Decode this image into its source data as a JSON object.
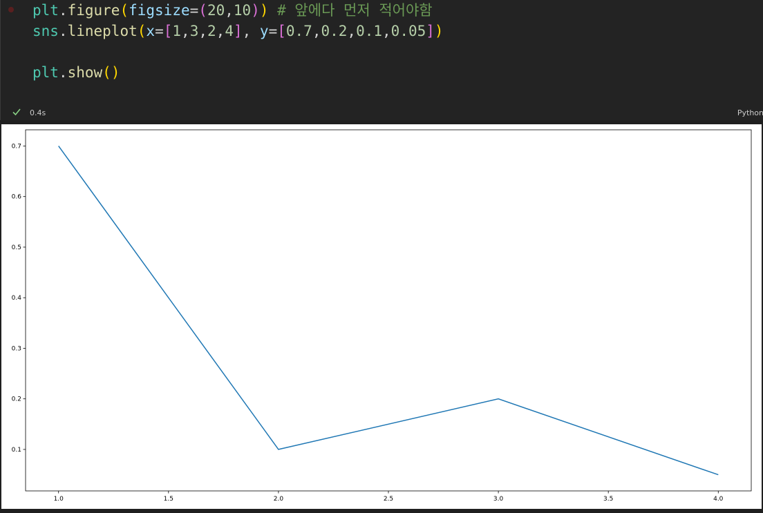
{
  "code_cell": {
    "lines": [
      [
        {
          "t": "plt",
          "c": "tok-var"
        },
        {
          "t": ".",
          "c": "tok-op"
        },
        {
          "t": "figure",
          "c": "tok-fn"
        },
        {
          "t": "(",
          "c": "tok-p1"
        },
        {
          "t": "figsize",
          "c": "tok-param"
        },
        {
          "t": "=",
          "c": "tok-op"
        },
        {
          "t": "(",
          "c": "tok-p2"
        },
        {
          "t": "20",
          "c": "tok-num"
        },
        {
          "t": ",",
          "c": "tok-op"
        },
        {
          "t": "10",
          "c": "tok-num"
        },
        {
          "t": ")",
          "c": "tok-p2"
        },
        {
          "t": ")",
          "c": "tok-p1"
        },
        {
          "t": " # 앞에다 먼저 적어야함",
          "c": "tok-comment"
        }
      ],
      [
        {
          "t": "sns",
          "c": "tok-var"
        },
        {
          "t": ".",
          "c": "tok-op"
        },
        {
          "t": "lineplot",
          "c": "tok-fn"
        },
        {
          "t": "(",
          "c": "tok-p1"
        },
        {
          "t": "x",
          "c": "tok-param"
        },
        {
          "t": "=",
          "c": "tok-op"
        },
        {
          "t": "[",
          "c": "tok-p2"
        },
        {
          "t": "1",
          "c": "tok-num"
        },
        {
          "t": ",",
          "c": "tok-op"
        },
        {
          "t": "3",
          "c": "tok-num"
        },
        {
          "t": ",",
          "c": "tok-op"
        },
        {
          "t": "2",
          "c": "tok-num"
        },
        {
          "t": ",",
          "c": "tok-op"
        },
        {
          "t": "4",
          "c": "tok-num"
        },
        {
          "t": "]",
          "c": "tok-p2"
        },
        {
          "t": ", ",
          "c": "tok-op"
        },
        {
          "t": "y",
          "c": "tok-param"
        },
        {
          "t": "=",
          "c": "tok-op"
        },
        {
          "t": "[",
          "c": "tok-p2"
        },
        {
          "t": "0.7",
          "c": "tok-num"
        },
        {
          "t": ",",
          "c": "tok-op"
        },
        {
          "t": "0.2",
          "c": "tok-num"
        },
        {
          "t": ",",
          "c": "tok-op"
        },
        {
          "t": "0.1",
          "c": "tok-num"
        },
        {
          "t": ",",
          "c": "tok-op"
        },
        {
          "t": "0.05",
          "c": "tok-num"
        },
        {
          "t": "]",
          "c": "tok-p2"
        },
        {
          "t": ")",
          "c": "tok-p1"
        }
      ],
      [],
      [
        {
          "t": "plt",
          "c": "tok-var"
        },
        {
          "t": ".",
          "c": "tok-op"
        },
        {
          "t": "show",
          "c": "tok-fn"
        },
        {
          "t": "(",
          "c": "tok-p1"
        },
        {
          "t": ")",
          "c": "tok-p1"
        }
      ]
    ]
  },
  "status": {
    "check_icon": "check-icon",
    "elapsed": "0.4s",
    "language": "Python"
  },
  "colors": {
    "line": "#1f77b4",
    "check": "#89d185"
  },
  "chart_data": {
    "type": "line",
    "x": [
      1,
      2,
      3,
      4
    ],
    "y": [
      0.7,
      0.1,
      0.2,
      0.05
    ],
    "xlim": [
      0.85,
      4.15
    ],
    "ylim": [
      0.018,
      0.732
    ],
    "xticks": [
      "1.0",
      "1.5",
      "2.0",
      "2.5",
      "3.0",
      "3.5",
      "4.0"
    ],
    "yticks": [
      "0.1",
      "0.2",
      "0.3",
      "0.4",
      "0.5",
      "0.6",
      "0.7"
    ],
    "grid": false,
    "title": "",
    "xlabel": "",
    "ylabel": ""
  }
}
